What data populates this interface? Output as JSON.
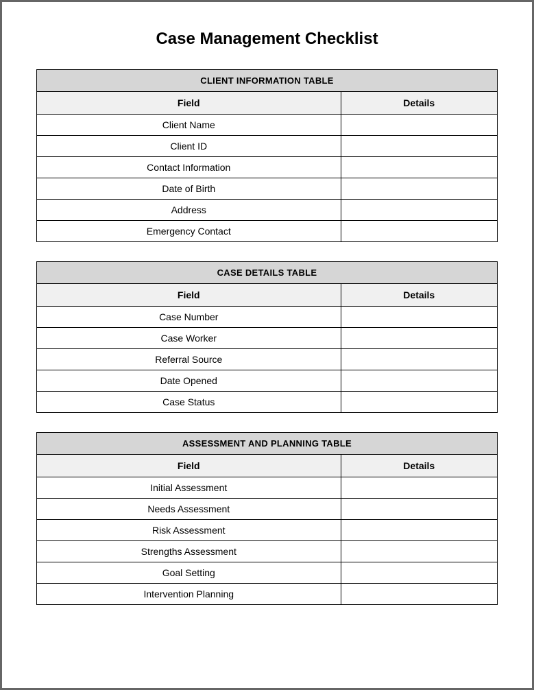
{
  "title": "Case Management Checklist",
  "tables": [
    {
      "name": "CLIENT INFORMATION TABLE",
      "headers": {
        "field": "Field",
        "details": "Details"
      },
      "rows": [
        {
          "field": "Client Name",
          "details": ""
        },
        {
          "field": "Client ID",
          "details": ""
        },
        {
          "field": "Contact Information",
          "details": ""
        },
        {
          "field": "Date of Birth",
          "details": ""
        },
        {
          "field": "Address",
          "details": ""
        },
        {
          "field": "Emergency Contact",
          "details": ""
        }
      ]
    },
    {
      "name": "CASE DETAILS TABLE",
      "headers": {
        "field": "Field",
        "details": "Details"
      },
      "rows": [
        {
          "field": "Case Number",
          "details": ""
        },
        {
          "field": "Case Worker",
          "details": ""
        },
        {
          "field": "Referral Source",
          "details": ""
        },
        {
          "field": "Date Opened",
          "details": ""
        },
        {
          "field": "Case Status",
          "details": ""
        }
      ]
    },
    {
      "name": "ASSESSMENT AND PLANNING TABLE",
      "headers": {
        "field": "Field",
        "details": "Details"
      },
      "rows": [
        {
          "field": "Initial Assessment",
          "details": ""
        },
        {
          "field": "Needs Assessment",
          "details": ""
        },
        {
          "field": "Risk Assessment",
          "details": ""
        },
        {
          "field": "Strengths Assessment",
          "details": ""
        },
        {
          "field": "Goal Setting",
          "details": ""
        },
        {
          "field": "Intervention Planning",
          "details": ""
        }
      ]
    }
  ]
}
